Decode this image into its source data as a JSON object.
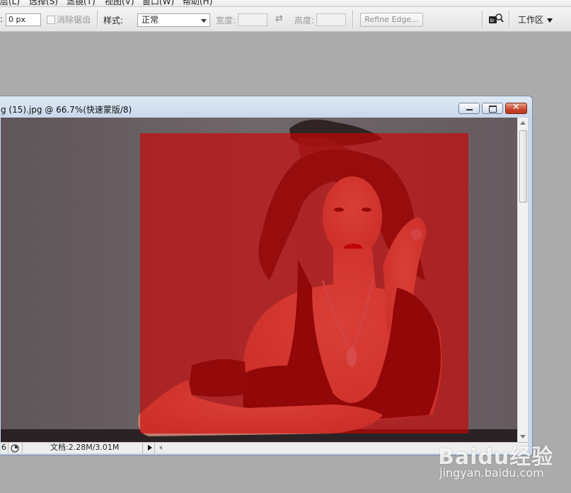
{
  "menubar": {
    "items": [
      "层(L)",
      "选择(S)",
      "滤镜(T)",
      "视图(V)",
      "窗口(W)",
      "帮助(H)"
    ]
  },
  "options": {
    "feather_value": "0 px",
    "antialias_label": "消除锯齿",
    "style_label": "样式:",
    "style_value": "正常",
    "width_label": "宽度:",
    "height_label": "高度:",
    "refine_edge_label": "Refine Edge...",
    "workspace_label": "工作区"
  },
  "document": {
    "title": "g (15).jpg @ 66.7%(快速蒙版/8)",
    "status_zoom": "6",
    "status_doc": "文档:2.28M/3.01M"
  },
  "selection": {
    "quick_mask_color": "#d40000",
    "quick_mask_opacity": 0.55
  },
  "watermark": {
    "logo": "Baidu经验",
    "url": "jingyan.baidu.com"
  }
}
